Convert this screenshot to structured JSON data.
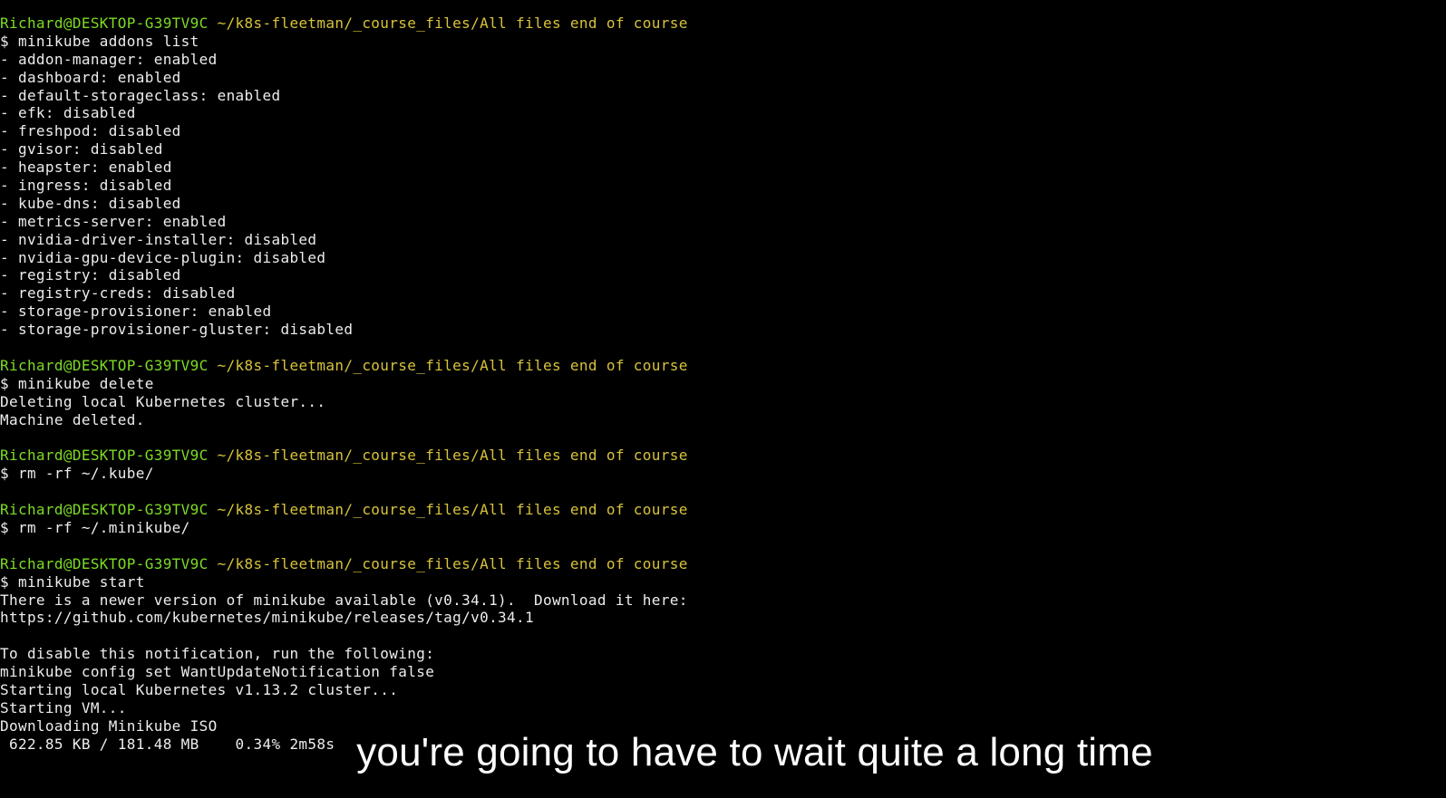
{
  "prompt": {
    "user": "Richard@DESKTOP-G39TV9C",
    "path": "~/k8s-fleetman/_course_files/All files end of course"
  },
  "blocks": [
    {
      "command": "$ minikube addons list",
      "output": [
        "- addon-manager: enabled",
        "- dashboard: enabled",
        "- default-storageclass: enabled",
        "- efk: disabled",
        "- freshpod: disabled",
        "- gvisor: disabled",
        "- heapster: enabled",
        "- ingress: disabled",
        "- kube-dns: disabled",
        "- metrics-server: enabled",
        "- nvidia-driver-installer: disabled",
        "- nvidia-gpu-device-plugin: disabled",
        "- registry: disabled",
        "- registry-creds: disabled",
        "- storage-provisioner: enabled",
        "- storage-provisioner-gluster: disabled"
      ]
    },
    {
      "command": "$ minikube delete",
      "output": [
        "Deleting local Kubernetes cluster...",
        "Machine deleted."
      ]
    },
    {
      "command": "$ rm -rf ~/.kube/",
      "output": []
    },
    {
      "command": "$ rm -rf ~/.minikube/",
      "output": []
    },
    {
      "command": "$ minikube start",
      "output": [
        "There is a newer version of minikube available (v0.34.1).  Download it here:",
        "https://github.com/kubernetes/minikube/releases/tag/v0.34.1",
        "",
        "To disable this notification, run the following:",
        "minikube config set WantUpdateNotification false",
        "Starting local Kubernetes v1.13.2 cluster...",
        "Starting VM...",
        "Downloading Minikube ISO",
        " 622.85 KB / 181.48 MB    0.34% 2m58s"
      ]
    }
  ],
  "subtitle": "you're going to have to wait quite a long time",
  "colors": {
    "background": "#000000",
    "prompt_user": "#7ddc25",
    "prompt_path": "#d8c33a",
    "text": "#ededed"
  }
}
